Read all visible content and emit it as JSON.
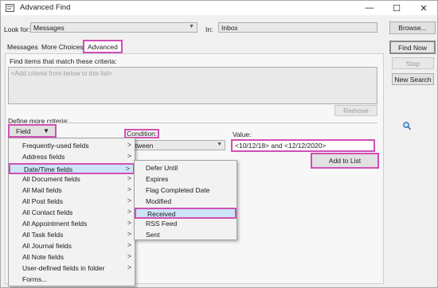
{
  "window": {
    "title": "Advanced Find",
    "minimize": "—",
    "maximize": "☐",
    "close": "✕"
  },
  "header": {
    "look_for_label": "Look for:",
    "look_for_value": "Messages",
    "in_label": "In:",
    "in_value": "Inbox",
    "browse_label": "Browse..."
  },
  "tabs": [
    {
      "label": "Messages"
    },
    {
      "label": "More Choices"
    },
    {
      "label": "Advanced"
    }
  ],
  "criteria": {
    "heading": "Find items that match these criteria:",
    "placeholder": "<Add criteria from below to this list>",
    "remove_label": "Remove"
  },
  "define": {
    "heading": "Define more criteria:",
    "field_label": "Field",
    "condition_label": "Condition:",
    "condition_value": "etween",
    "value_label": "Value:",
    "value_value": "<10/12/18> and <12/12/2020>",
    "add_label": "Add to List"
  },
  "actions": {
    "find_now": "Find Now",
    "stop": "Stop",
    "new_search": "New Search"
  },
  "field_menu": [
    {
      "label": "Frequently-used fields",
      "submenu": true
    },
    {
      "label": "Address fields",
      "submenu": true
    },
    {
      "label": "Date/Time fields",
      "submenu": true,
      "selected": true
    },
    {
      "label": "All Document fields",
      "submenu": true
    },
    {
      "label": "All Mail fields",
      "submenu": true
    },
    {
      "label": "All Post fields",
      "submenu": true
    },
    {
      "label": "All Contact fields",
      "submenu": true
    },
    {
      "label": "All Appointment fields",
      "submenu": true
    },
    {
      "label": "All Task fields",
      "submenu": true
    },
    {
      "label": "All Journal fields",
      "submenu": true
    },
    {
      "label": "All Note fields",
      "submenu": true
    },
    {
      "label": "User-defined fields in folder",
      "submenu": true
    },
    {
      "label": "Forms...",
      "submenu": false
    }
  ],
  "datetime_submenu": [
    {
      "label": "Defer Until"
    },
    {
      "label": "Expires"
    },
    {
      "label": "Flag Completed Date"
    },
    {
      "label": "Modified"
    },
    {
      "label": "Received",
      "selected": true
    },
    {
      "label": "RSS Feed"
    },
    {
      "label": "Sent"
    }
  ],
  "chevron": ">",
  "icons": {
    "app": "advanced-find-icon",
    "dropdown": "chevron-down-icon",
    "search": "magnifier-icon"
  },
  "colors": {
    "highlight_border": "#d14fb6",
    "selected_fill": "#cce4f7"
  }
}
